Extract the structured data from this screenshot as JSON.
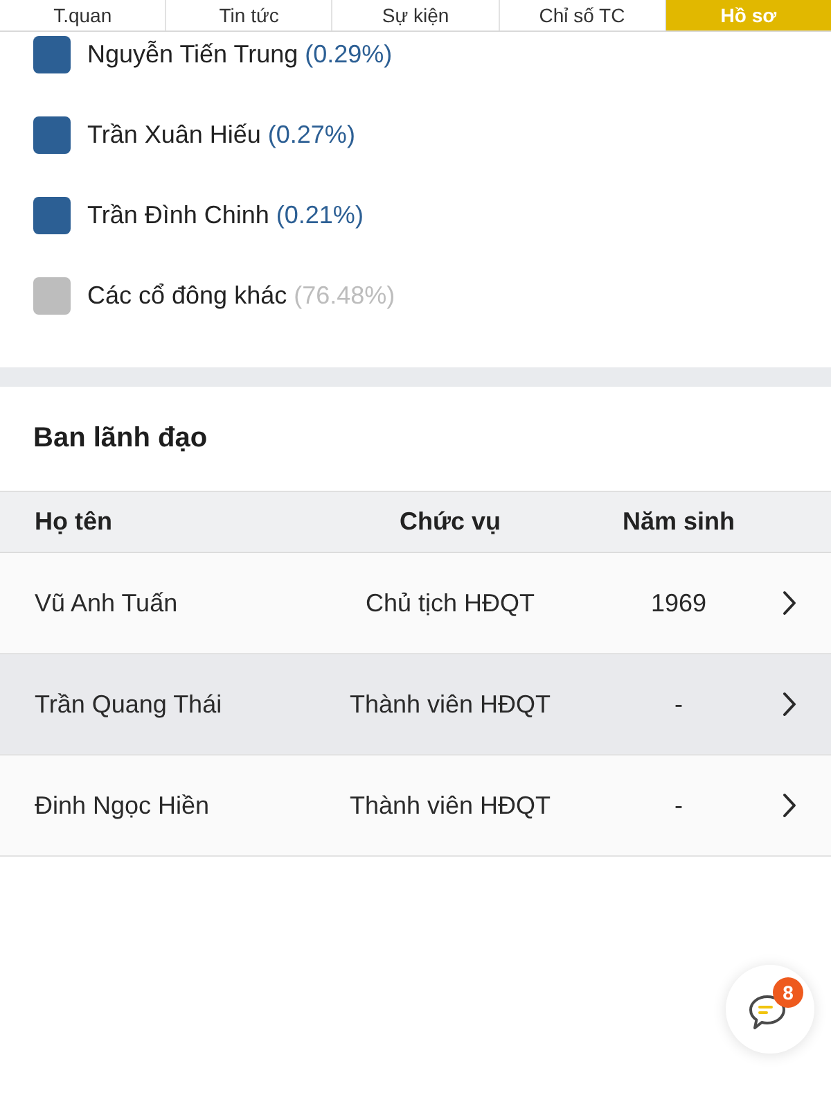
{
  "tabs": [
    {
      "label": "T.quan",
      "selected": false
    },
    {
      "label": "Tin tức",
      "selected": false
    },
    {
      "label": "Sự kiện",
      "selected": false
    },
    {
      "label": "Chỉ số TC",
      "selected": false
    },
    {
      "label": "Hồ sơ",
      "selected": true
    }
  ],
  "shareholders": [
    {
      "name": "Nguyễn Tiến Trung",
      "percent": "(0.29%)",
      "color": "#2c5f94"
    },
    {
      "name": "Trần Xuân Hiếu",
      "percent": "(0.27%)",
      "color": "#2c5f94"
    },
    {
      "name": "Trần Đình Chinh",
      "percent": "(0.21%)",
      "color": "#2c5f94"
    },
    {
      "name": "Các cổ đông khác",
      "percent": "(76.48%)",
      "color": "#bdbdbd"
    }
  ],
  "leadership": {
    "title": "Ban lãnh đạo",
    "columns": [
      "Họ tên",
      "Chức vụ",
      "Năm sinh"
    ],
    "rows": [
      {
        "name": "Vũ Anh Tuấn",
        "position": "Chủ tịch HĐQT",
        "birth_year": "1969"
      },
      {
        "name": "Trần Quang Thái",
        "position": "Thành viên HĐQT",
        "birth_year": "-"
      },
      {
        "name": "Đinh Ngọc Hiền",
        "position": "Thành viên HĐQT",
        "birth_year": "-"
      }
    ]
  },
  "chat_button": {
    "badge": "8"
  }
}
